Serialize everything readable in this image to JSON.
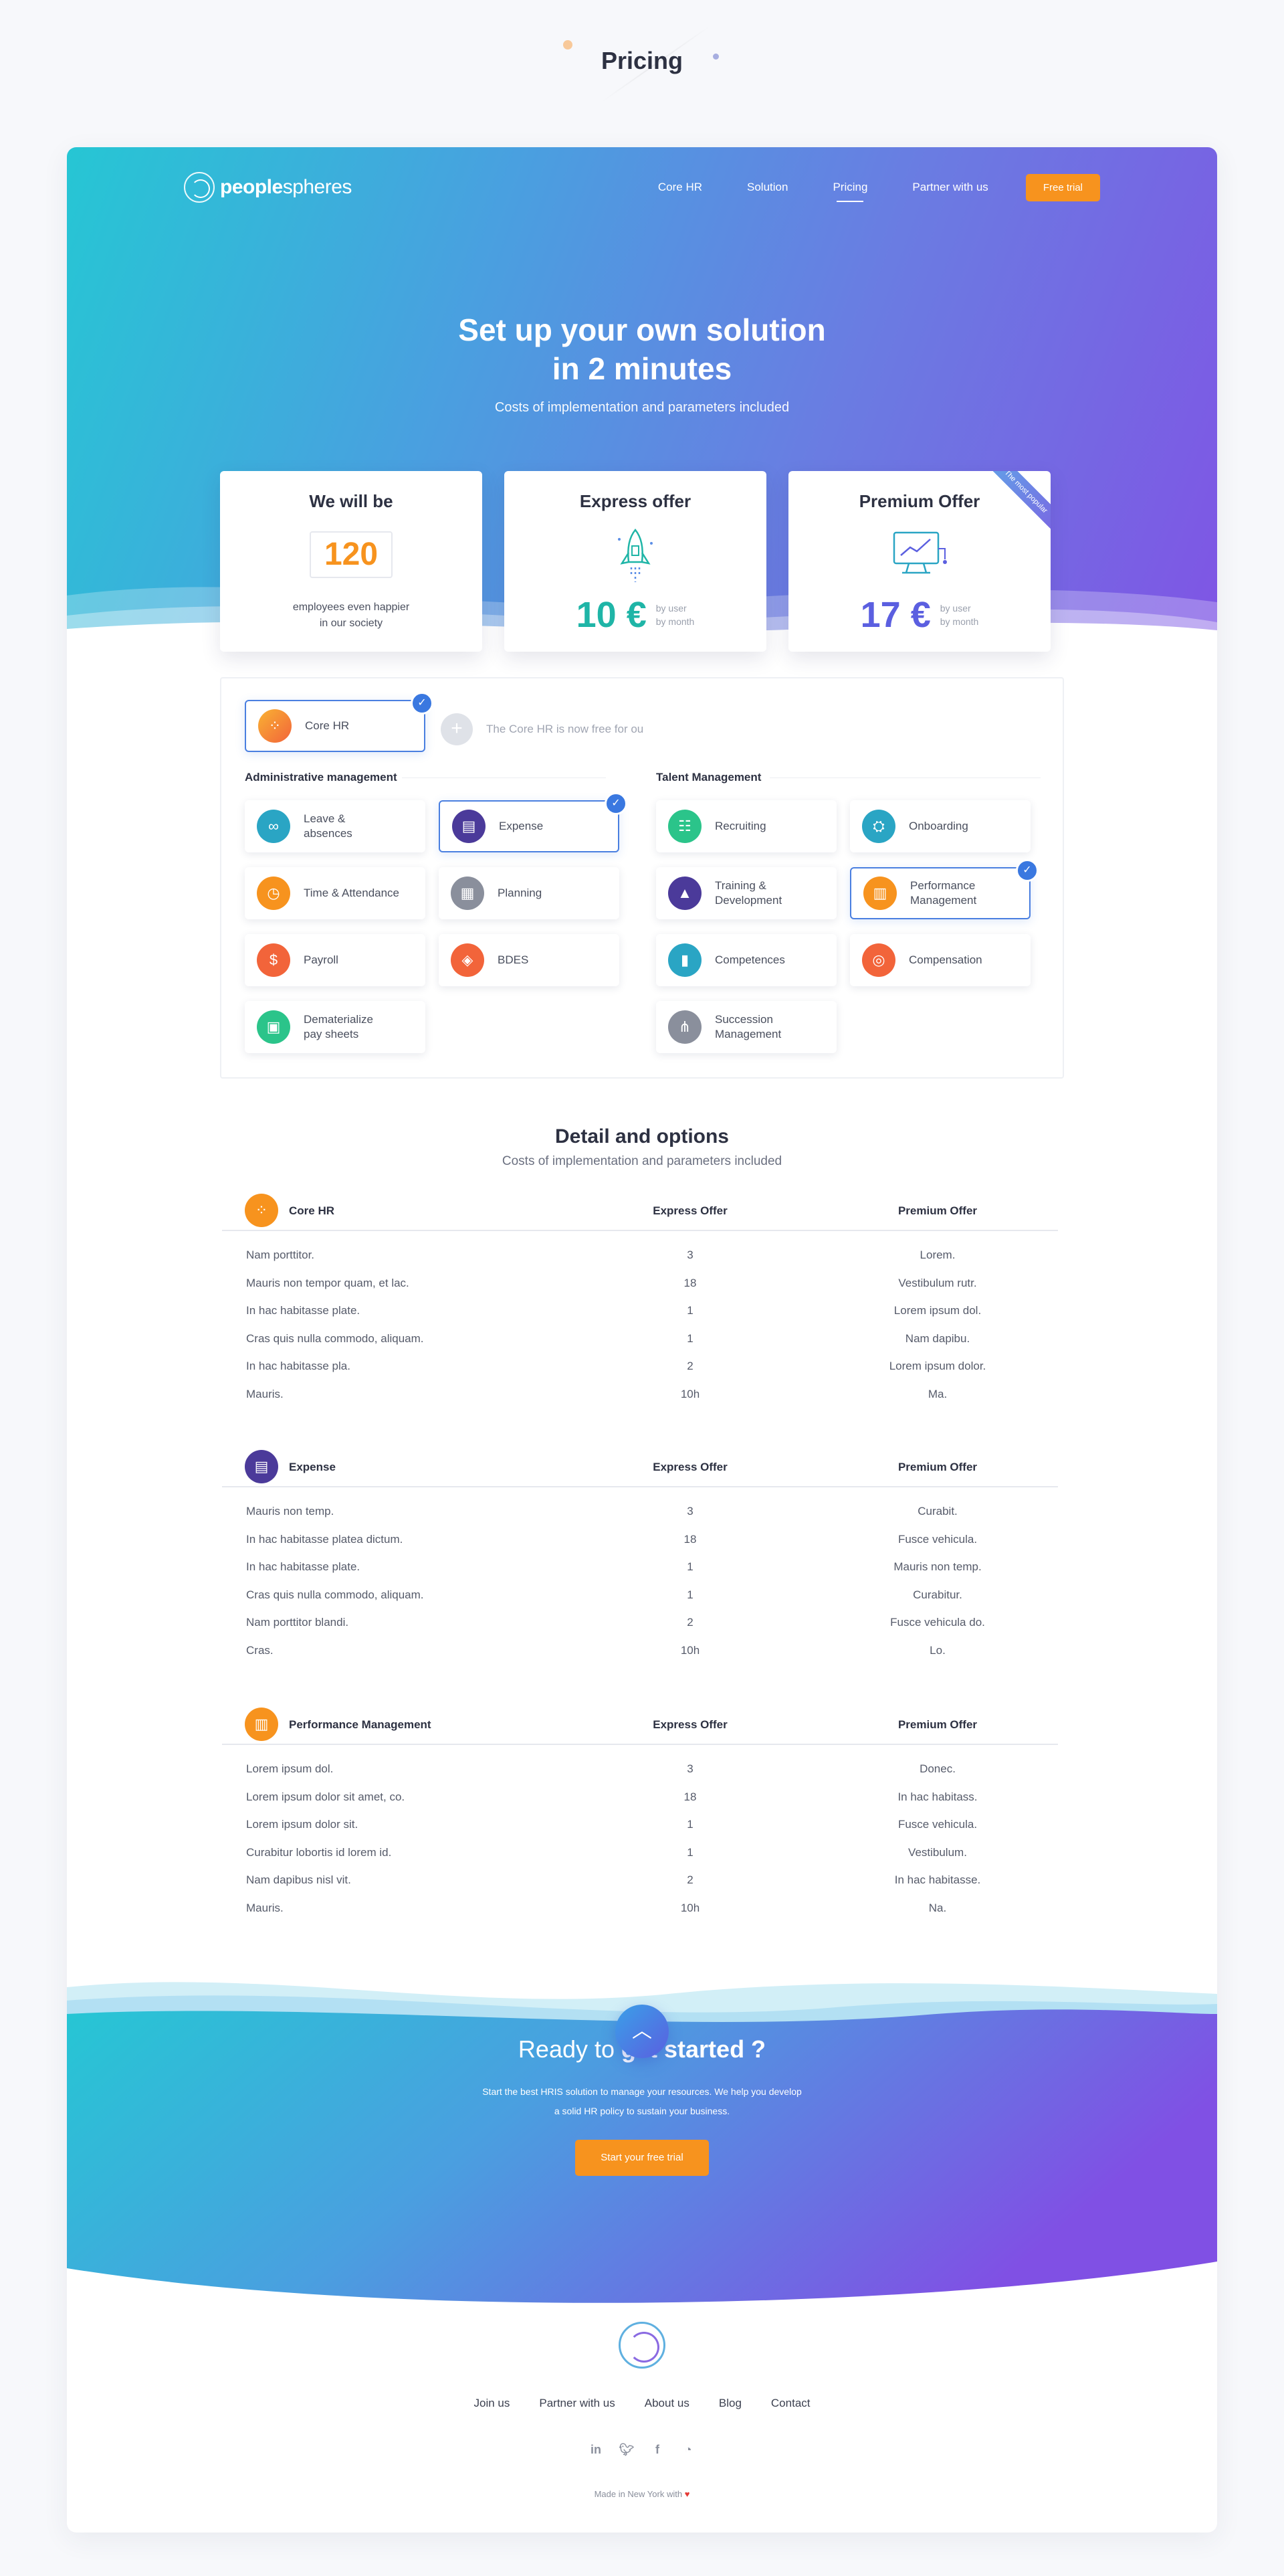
{
  "page_title": "Pricing",
  "nav": {
    "logo_primary": "people",
    "logo_secondary": "spheres",
    "links": [
      "Core HR",
      "Solution",
      "Pricing",
      "Partner with us"
    ],
    "cta": "Free trial"
  },
  "hero": {
    "title_line1": "Set up your own solution",
    "title_line2": "in 2 minutes",
    "subtitle": "Costs of implementation and parameters included"
  },
  "offers": [
    {
      "title": "We will be",
      "counter": "120",
      "desc_line1": "employees even happier",
      "desc_line2": "in our society"
    },
    {
      "title": "Express offer",
      "price": "10 €",
      "note_line1": "by user",
      "note_line2": "by month",
      "icon": "rocket-icon"
    },
    {
      "title": "Premium Offer",
      "price": "17 €",
      "note_line1": "by user",
      "note_line2": "by month",
      "icon": "monitor-chart-icon",
      "ribbon": "The most popular"
    }
  ],
  "modules": {
    "core": {
      "label": "Core HR",
      "selected": true,
      "note": "The Core HR is now free for ou"
    },
    "admin_title": "Administrative management",
    "talent_title": "Talent Management",
    "admin_items": [
      {
        "label_1": "Leave &",
        "label_2": "absences",
        "icon": "binoculars-icon",
        "color": "#2aa5c4",
        "selected": false
      },
      {
        "label_1": "Expense",
        "label_2": "",
        "icon": "receipt-icon",
        "color": "#4b3a9a",
        "selected": true
      },
      {
        "label_1": "Time & Attendance",
        "label_2": "",
        "icon": "clock-icon",
        "color": "#f7931e",
        "selected": false
      },
      {
        "label_1": "Planning",
        "label_2": "",
        "icon": "calendar-icon",
        "color": "#8a8f9c",
        "selected": false
      },
      {
        "label_1": "Payroll",
        "label_2": "",
        "icon": "money-bag-icon",
        "color": "#f2643a",
        "selected": false
      },
      {
        "label_1": "BDES",
        "label_2": "",
        "icon": "cube-icon",
        "color": "#f2643a",
        "selected": false
      },
      {
        "label_1": "Dematerialize",
        "label_2": "pay sheets",
        "icon": "document-icon",
        "color": "#2bc48a",
        "selected": false
      }
    ],
    "talent_items": [
      {
        "label_1": "Recruiting",
        "label_2": "",
        "icon": "users-icon",
        "color": "#2bc48a",
        "selected": false
      },
      {
        "label_1": "Onboarding",
        "label_2": "",
        "icon": "team-icon",
        "color": "#2aa5c4",
        "selected": false
      },
      {
        "label_1": "Training &",
        "label_2": "Development",
        "icon": "graduation-icon",
        "color": "#4b3a9a",
        "selected": false
      },
      {
        "label_1": "Performance",
        "label_2": "Management",
        "icon": "clipboard-icon",
        "color": "#f7931e",
        "selected": true
      },
      {
        "label_1": "Competences",
        "label_2": "",
        "icon": "chart-icon",
        "color": "#2aa5c4",
        "selected": false
      },
      {
        "label_1": "Compensation",
        "label_2": "",
        "icon": "coins-icon",
        "color": "#f2643a",
        "selected": false
      },
      {
        "label_1": "Succession",
        "label_2": "Management",
        "icon": "hierarchy-icon",
        "color": "#8a8f9c",
        "selected": false
      }
    ]
  },
  "detail": {
    "title": "Detail and options",
    "subtitle": "Costs of implementation and parameters included",
    "col_express": "Express Offer",
    "col_premium": "Premium Offer",
    "tables": [
      {
        "name": "Core HR",
        "icon": "core-hr-icon",
        "color": "#f7931e",
        "rows": [
          [
            "Nam porttitor.",
            "3",
            "Lorem."
          ],
          [
            "Mauris non tempor quam, et lac.",
            "18",
            "Vestibulum rutr."
          ],
          [
            "In hac habitasse plate.",
            "1",
            "Lorem ipsum dol."
          ],
          [
            "Cras quis nulla commodo, aliquam.",
            "1",
            "Nam dapibu."
          ],
          [
            "In hac habitasse pla.",
            "2",
            "Lorem ipsum dolor."
          ],
          [
            "Mauris.",
            "10h",
            "Ma."
          ]
        ]
      },
      {
        "name": "Expense",
        "icon": "receipt-icon",
        "color": "#4b3a9a",
        "rows": [
          [
            "Mauris non temp.",
            "3",
            "Curabit."
          ],
          [
            "In hac habitasse platea dictum.",
            "18",
            "Fusce vehicula."
          ],
          [
            "In hac habitasse plate.",
            "1",
            "Mauris non temp."
          ],
          [
            "Cras quis nulla commodo, aliquam.",
            "1",
            "Curabitur."
          ],
          [
            "Nam porttitor blandi.",
            "2",
            "Fusce vehicula do."
          ],
          [
            "Cras.",
            "10h",
            "Lo."
          ]
        ]
      },
      {
        "name": "Performance Management",
        "icon": "clipboard-icon",
        "color": "#f7931e",
        "rows": [
          [
            "Lorem ipsum dol.",
            "3",
            "Donec."
          ],
          [
            "Lorem ipsum dolor sit amet, co.",
            "18",
            "In hac habitass."
          ],
          [
            "Lorem ipsum dolor sit.",
            "1",
            "Fusce vehicula."
          ],
          [
            "Curabitur lobortis id lorem id.",
            "1",
            "Vestibulum."
          ],
          [
            "Nam dapibus nisl vit.",
            "2",
            "In hac habitasse."
          ],
          [
            "Mauris.",
            "10h",
            "Na."
          ]
        ]
      }
    ]
  },
  "cta": {
    "title_plain": "Ready to ",
    "title_bold": "get started ?",
    "text_line1": "Start the best HRIS solution to manage your resources. We help you develop",
    "text_line2": "a solid HR policy to sustain your business.",
    "button": "Start your free trial"
  },
  "footer": {
    "links": [
      "Join us",
      "Partner with us",
      "About us",
      "Blog",
      "Contact"
    ],
    "social": [
      "linkedin-icon",
      "twitter-icon",
      "facebook-icon",
      "rss-icon"
    ],
    "made_in": "Made in New York with"
  },
  "colors": {
    "accent": "#f7931e",
    "blue": "#3a78e0",
    "teal": "#1fb5a7",
    "violet": "#5b5fe0"
  }
}
